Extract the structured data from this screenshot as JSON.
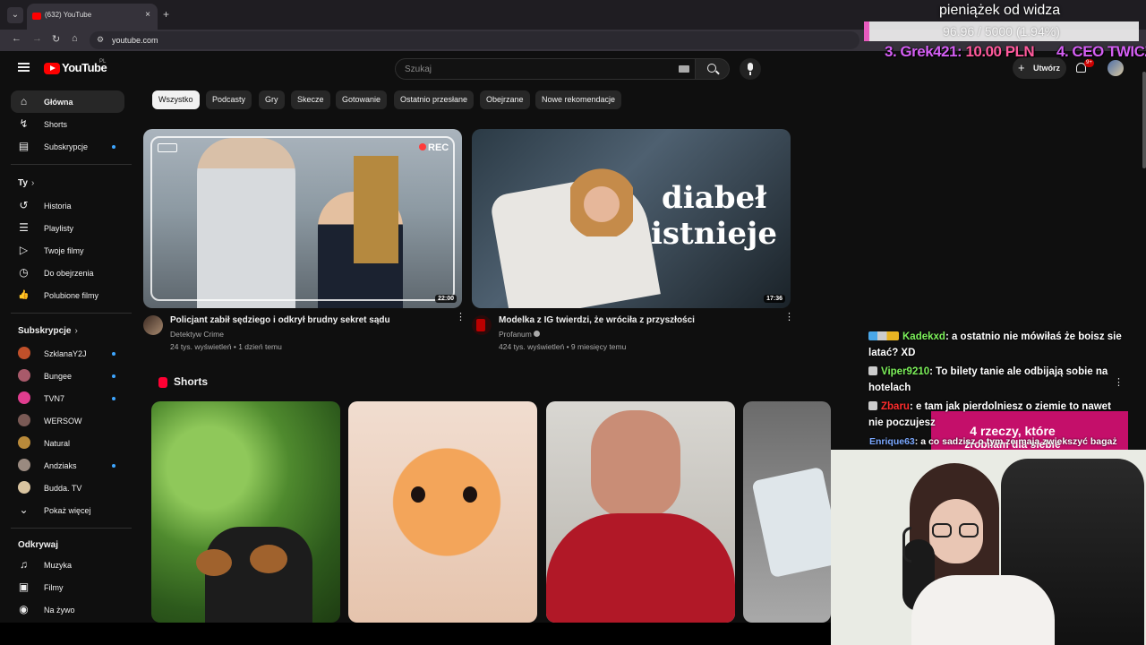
{
  "browser": {
    "tab_title": "(632) YouTube",
    "url": "youtube.com",
    "new_tab_symbol": "+",
    "close_symbol": "×"
  },
  "header": {
    "logo_text": "YouTube",
    "country_code": "PL",
    "search_placeholder": "Szukaj",
    "create_label": "Utwórz",
    "create_symbol": "+",
    "notification_count": "9+"
  },
  "sidebar": {
    "main": [
      {
        "label": "Główna",
        "icon": "home-icon",
        "glyph": "⌂"
      },
      {
        "label": "Shorts",
        "icon": "shorts-icon",
        "glyph": "↯"
      },
      {
        "label": "Subskrypcje",
        "icon": "subscriptions-icon",
        "glyph": "▤"
      }
    ],
    "you_heading": "Ty",
    "you": [
      {
        "label": "Historia",
        "icon": "history-icon",
        "glyph": "↺"
      },
      {
        "label": "Playlisty",
        "icon": "playlists-icon",
        "glyph": "☰"
      },
      {
        "label": "Twoje filmy",
        "icon": "your-videos-icon",
        "glyph": "▷"
      },
      {
        "label": "Do obejrzenia",
        "icon": "watch-later-icon",
        "glyph": "◷"
      },
      {
        "label": "Polubione filmy",
        "icon": "liked-icon",
        "glyph": "👍"
      }
    ],
    "subs_heading": "Subskrypcje",
    "subs": [
      {
        "label": "SzklanaY2J",
        "color": "#c0502a"
      },
      {
        "label": "Bungee",
        "color": "#a85a6a"
      },
      {
        "label": "TVN7",
        "color": "#e03d8f"
      },
      {
        "label": "WERSOW",
        "color": "#7a5a55"
      },
      {
        "label": "Natural",
        "color": "#b98a3a"
      },
      {
        "label": "Andziaks",
        "color": "#9a8a80"
      },
      {
        "label": "Budda. TV",
        "color": "#d9c4a0"
      }
    ],
    "show_more": "Pokaż więcej",
    "explore_heading": "Odkrywaj",
    "explore": [
      {
        "label": "Muzyka",
        "icon": "music-icon",
        "glyph": "♫"
      },
      {
        "label": "Filmy",
        "icon": "movies-icon",
        "glyph": "▣"
      },
      {
        "label": "Na żywo",
        "icon": "live-icon",
        "glyph": "◉"
      }
    ]
  },
  "chips": [
    "Wszystko",
    "Podcasty",
    "Gry",
    "Skecze",
    "Gotowanie",
    "Ostatnio przesłane",
    "Obejrzane",
    "Nowe rekomendacje"
  ],
  "videos": [
    {
      "title": "Policjant zabił sędziego i odkrył brudny sekret sądu",
      "channel": "Detektyw Crime",
      "meta": "24 tys. wyświetleń • 1 dzień temu",
      "duration": "22:00",
      "rec_label": "REC"
    },
    {
      "title": "Modelka z IG twierdzi, że wróciła z przyszłości",
      "channel": "Profanum",
      "meta": "424 tys. wyświetleń • 9 miesięcy temu",
      "duration": "17:36",
      "overlay_text_1": "diabeł",
      "overlay_text_2": "istnieje"
    }
  ],
  "shorts_heading": "Shorts",
  "overlay": {
    "donation_title": "pieniążek od widza",
    "donation_progress": "96.96 / 5000 (1.94%)",
    "donation_fraction": 0.0194,
    "donors": [
      {
        "rank": "3.",
        "name": "Grek421:",
        "amount": "10.00 PLN"
      },
      {
        "rank": "4.",
        "name": "CEO TWICZ",
        "amount": ""
      }
    ],
    "chat": [
      {
        "user": "Kadekxd",
        "color": "#7cf05a",
        "text": ": a ostatnio nie mówiłaś że boisz sie latać? XD"
      },
      {
        "user": "Viper9210",
        "color": "#7cf05a",
        "text": ": To bilety tanie ale odbijają sobie na hotelach"
      },
      {
        "user": "Zbaru",
        "color": "#ff2d2d",
        "text": ": e tam jak pierdolniesz o ziemie to nawet nie poczujesz"
      },
      {
        "user": "Enrique63",
        "color": "#7aa8ff",
        "text": ": a co sadzisz o tym ze maja zwiekszyć bagaż"
      }
    ],
    "pink_box_text": "4 rzeczy, które",
    "pink_box_text_2": "zrobiłam dla siebie"
  }
}
